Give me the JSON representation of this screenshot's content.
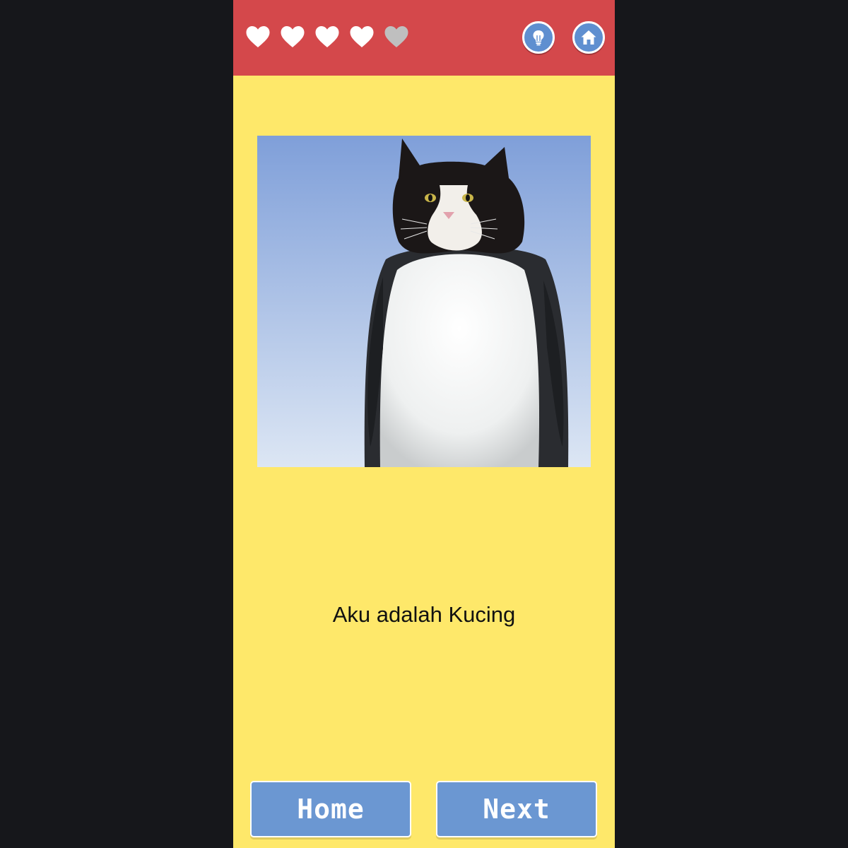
{
  "header": {
    "lives_total": 5,
    "lives_remaining": 4,
    "heart_colors": {
      "full": "#ffffff",
      "empty": "#bfbfbf"
    },
    "hint_button_icon": "lightbulb-icon",
    "home_button_icon": "home-icon"
  },
  "main": {
    "image_icon": "cat-penguin-image",
    "caption": "Aku adalah Kucing"
  },
  "footer": {
    "home_label": "Home",
    "next_label": "Next"
  },
  "colors": {
    "background": "#16171b",
    "panel": "#fee86a",
    "topbar": "#d4484b",
    "button": "#6b97d2"
  }
}
